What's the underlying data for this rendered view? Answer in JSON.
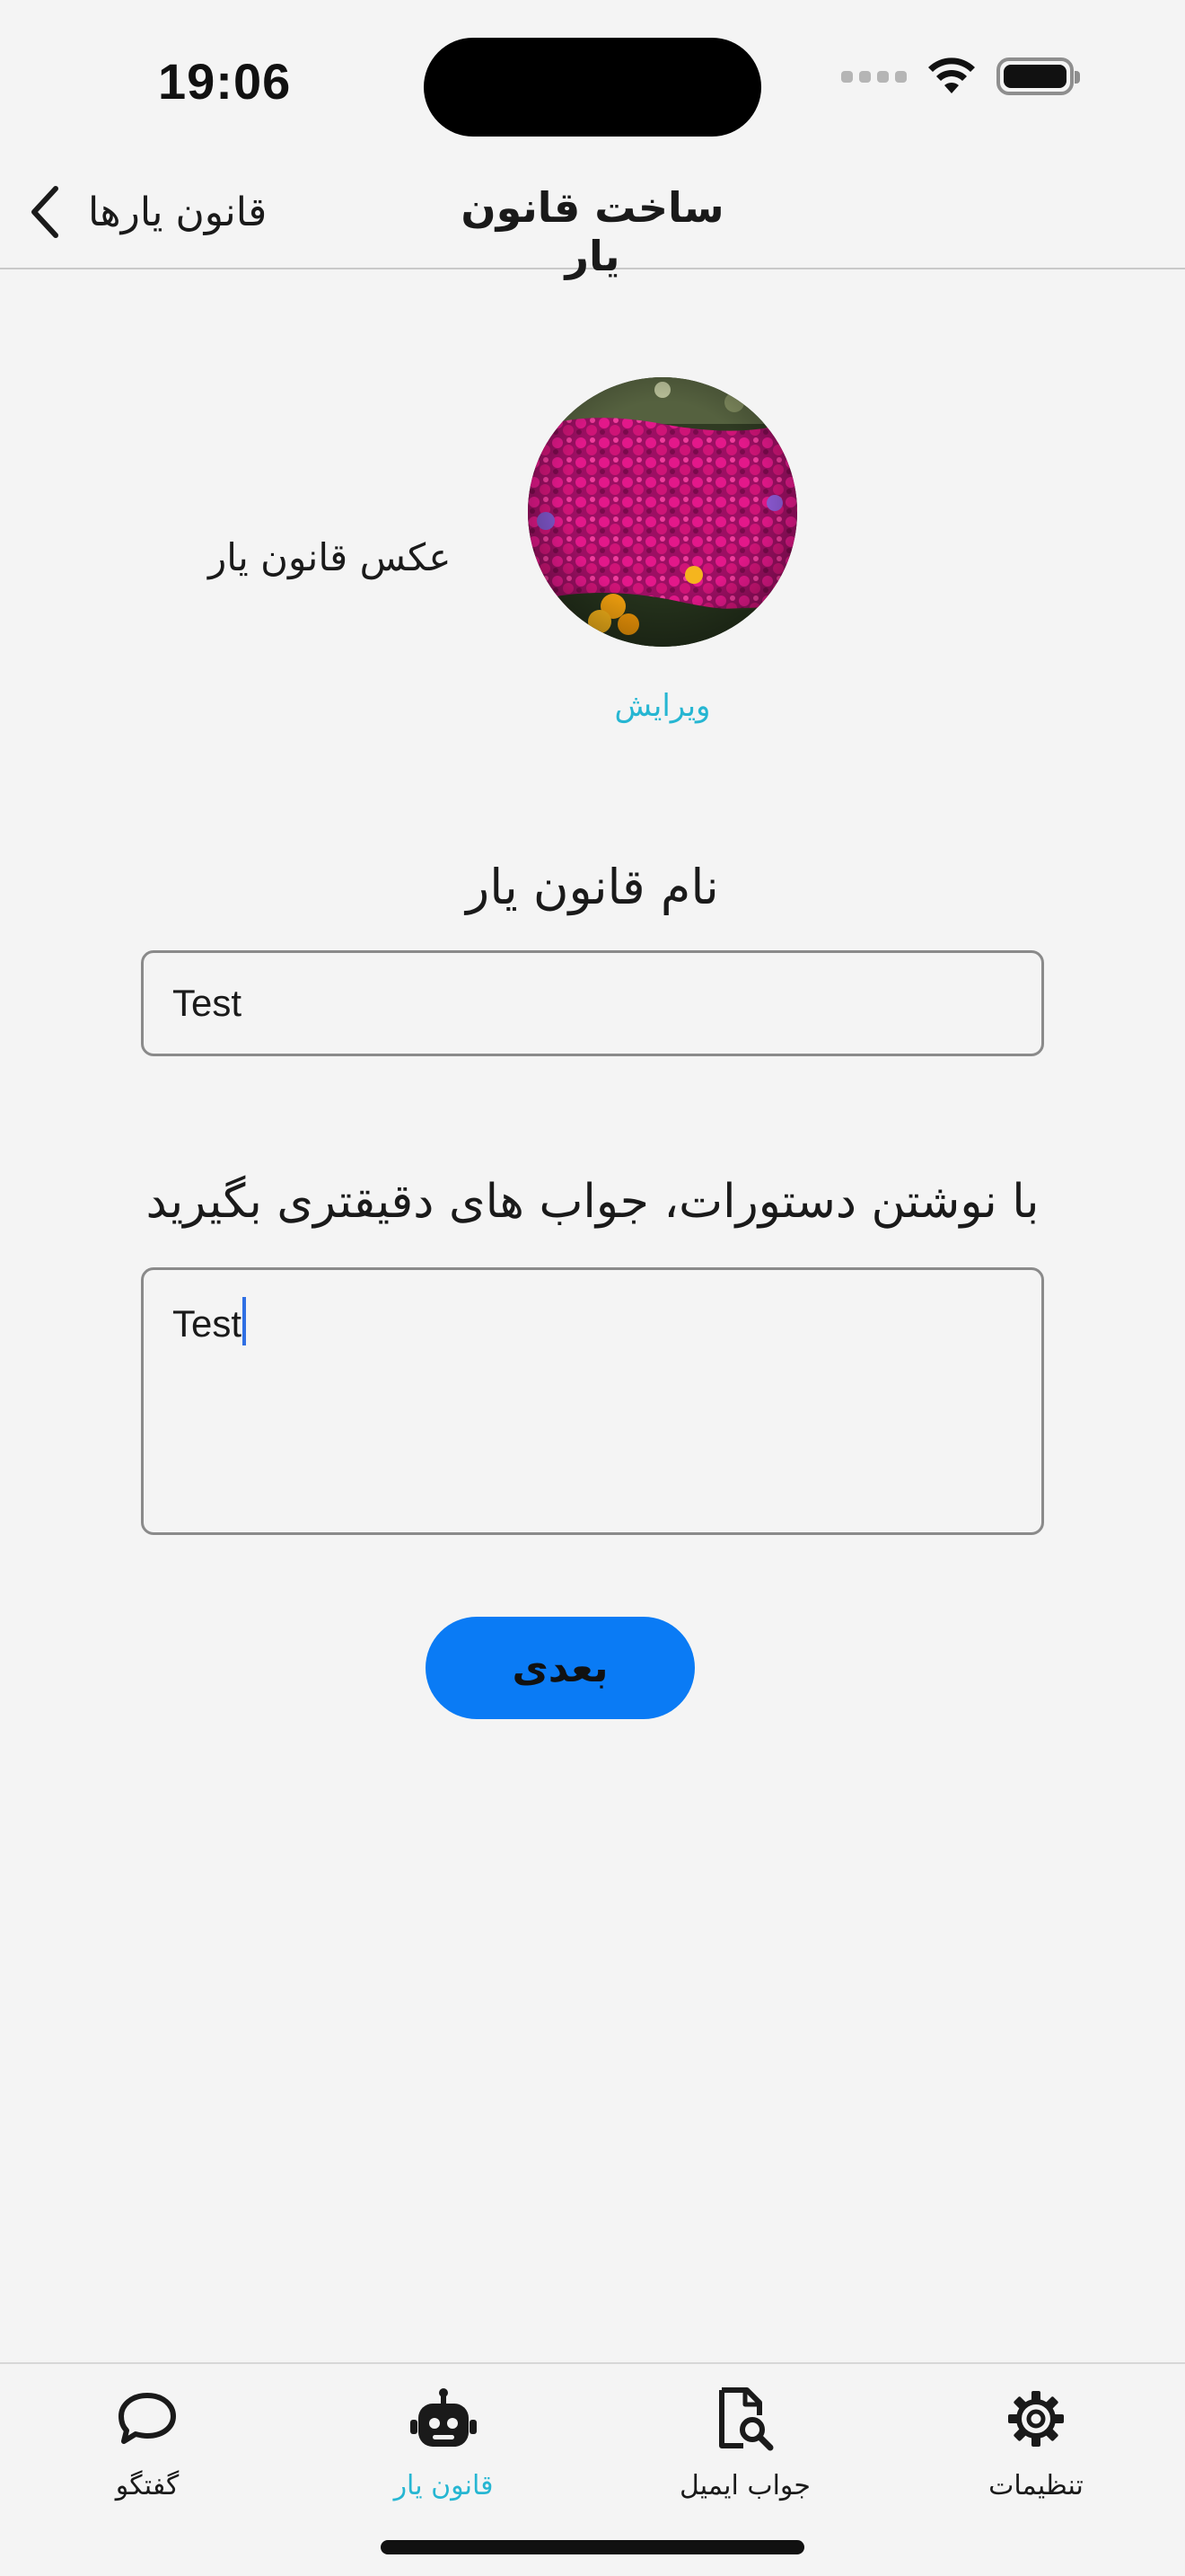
{
  "status_bar": {
    "time": "19:06"
  },
  "navbar": {
    "title": "ساخت قانون یار",
    "back_label": "قانون یارها"
  },
  "avatar_section": {
    "label": "عکس قانون یار",
    "edit_label": "ویرایش"
  },
  "name_field": {
    "label": "نام قانون یار",
    "value": "Test"
  },
  "instructions_field": {
    "label": "با نوشتن دستورات، جواب های دقیقتری بگیرید",
    "value": "Test"
  },
  "next_button": {
    "label": "بعدی"
  },
  "tabbar": {
    "tabs": [
      {
        "label": "گفتگو",
        "icon": "chat-bubble-icon",
        "active": false
      },
      {
        "label": "قانون یار",
        "icon": "robot-icon",
        "active": true
      },
      {
        "label": "جواب ایمیل",
        "icon": "document-search-icon",
        "active": false
      },
      {
        "label": "تنظیمات",
        "icon": "gear-icon",
        "active": false
      }
    ]
  },
  "colors": {
    "accent": "#26b6d2",
    "button": "#0a7bf5",
    "background": "#f4f4f4"
  }
}
